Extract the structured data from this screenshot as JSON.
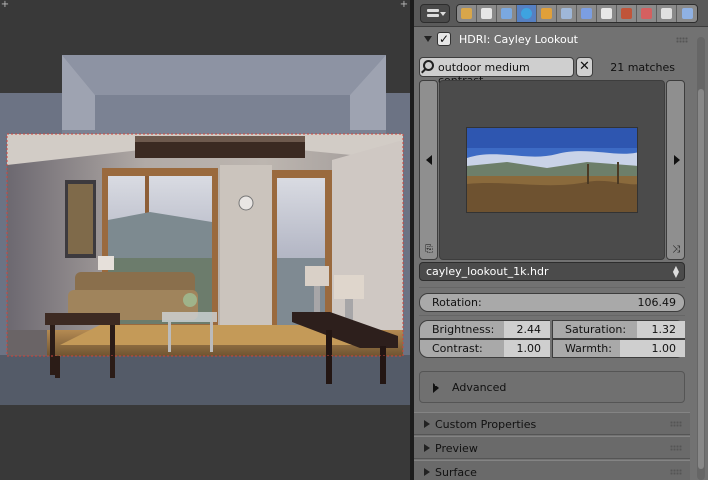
{
  "viewport": {
    "corner_left_icon": "plus",
    "corner_right_icon": "plus"
  },
  "header": {
    "editor_type_icon": "properties-editor-icon",
    "context_tabs": [
      {
        "name": "render",
        "color": "#d8a64a"
      },
      {
        "name": "render-layers",
        "color": "#e7e7e7"
      },
      {
        "name": "scene",
        "color": "#7aa8e0"
      },
      {
        "name": "world",
        "color": "#3ea3e0",
        "active": true
      },
      {
        "name": "object",
        "color": "#e0a03a"
      },
      {
        "name": "constraints",
        "color": "#9fb7d8"
      },
      {
        "name": "modifiers",
        "color": "#7b9ee2"
      },
      {
        "name": "data",
        "color": "#e8e8e8"
      },
      {
        "name": "material",
        "color": "#c0553a"
      },
      {
        "name": "texture",
        "color": "#d46060"
      },
      {
        "name": "particles",
        "color": "#e0e0e0"
      },
      {
        "name": "physics",
        "color": "#8fb1e3"
      }
    ]
  },
  "hdri_panel": {
    "title": "HDRI: Cayley Lookout",
    "enabled": true,
    "search_text": "outdoor medium contrast",
    "matches": "21 matches",
    "selected_file": "cayley_lookout_1k.hdr"
  },
  "controls": {
    "rotation": {
      "label": "Rotation:",
      "value": "106.49"
    },
    "brightness": {
      "label": "Brightness:",
      "value": "2.44"
    },
    "saturation": {
      "label": "Saturation:",
      "value": "1.32"
    },
    "contrast": {
      "label": "Contrast:",
      "value": "1.00"
    },
    "warmth": {
      "label": "Warmth:",
      "value": "1.00"
    }
  },
  "advanced_label": "Advanced",
  "sections": [
    {
      "label": "Custom Properties"
    },
    {
      "label": "Preview"
    },
    {
      "label": "Surface"
    }
  ],
  "colors": {
    "active_tab": "#5680c2",
    "panel_bg": "#727272",
    "viewport_bg": "#393939"
  }
}
